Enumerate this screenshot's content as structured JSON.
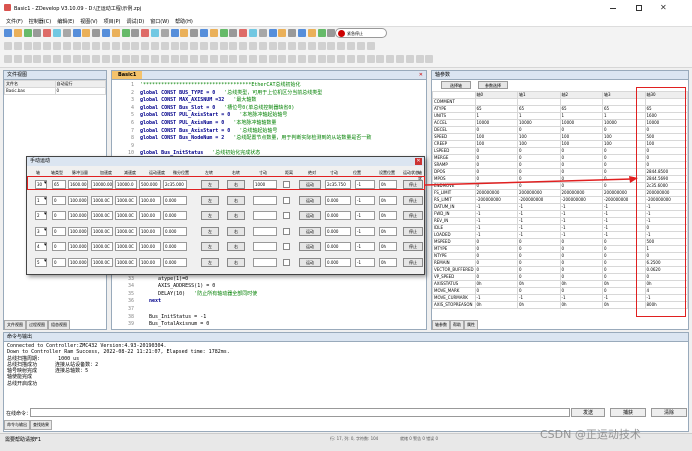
{
  "app": {
    "title": "Basic1 - ZDevelop V3.10.09 - D:\\正运动工程\\示例.zpj",
    "menus": [
      "文件(F)",
      "控制器(C)",
      "编辑(E)",
      "视图(V)",
      "项目(P)",
      "调试(D)",
      "窗口(W)",
      "帮助(H)"
    ],
    "stop_label": "紧急停止"
  },
  "file_view": {
    "title": "文件视图",
    "col_name": "文件名",
    "col_autorun": "自动运行",
    "file_name": "Basic.bas",
    "autorun": "0",
    "tabs": [
      "文件视图",
      "过程视图",
      "组态视图"
    ]
  },
  "editor": {
    "tab": "Basic1",
    "lines": [
      {
        "n": "1",
        "t": "'************************************EtherCAT总线初始化"
      },
      {
        "n": "2",
        "t": "global CONST BUS_TYPE = 0",
        "c": "'总线类型，可用于上位机区分当前总线类型"
      },
      {
        "n": "3",
        "t": "global CONST MAX_AXISNUM =32",
        "c": "'最大轴数"
      },
      {
        "n": "4",
        "t": "global CONST Bus_Slot = 0",
        "c": "'槽位号0(单总线控制器缺省0)"
      },
      {
        "n": "5",
        "t": "global CONST PUL_AxisStart = 0",
        "c": "'本地脉冲轴起始轴号"
      },
      {
        "n": "6",
        "t": "global CONST PUL_AxisNum = 0",
        "c": "'本地脉冲轴轴数量"
      },
      {
        "n": "7",
        "t": "global CONST Bus_AxisStart = 0",
        "c": "'总线轴起始轴号"
      },
      {
        "n": "8",
        "t": "global CONST Bus_NodeNum = 2",
        "c": "'总线配置节点数量，用于判断实际检测到的从站数量是否一致"
      },
      {
        "n": "9",
        "t": ""
      },
      {
        "n": "10",
        "t": "global Bus_InitStatus",
        "c": "'总线初始化完成状态"
      },
      {
        "n": "11",
        "t": "Bus_InitStatus = -1"
      },
      {
        "n": "12",
        "t": "global  Bus_TotalAxisnum",
        "c": "'检查扫描的总轴数"
      }
    ],
    "lines_bottom": [
      {
        "n": "32",
        "t": "      AXIS_ENABLE(1) = 0"
      },
      {
        "n": "33",
        "t": "      atype(1)=0"
      },
      {
        "n": "34",
        "t": "      AXIS_ADDRESS(1) = 0"
      },
      {
        "n": "35",
        "t": "      DELAY(10)",
        "c": "'防止所有轴动器全部同时使"
      },
      {
        "n": "36",
        "t": "   next"
      },
      {
        "n": "37",
        "t": ""
      },
      {
        "n": "38",
        "t": "   Bus_InitStatus = -1"
      },
      {
        "n": "39",
        "t": "   Bus_TotalAxisnum = 0"
      }
    ]
  },
  "dialog": {
    "title": "手动运动",
    "headers": [
      "轴",
      "轴类型",
      "脉冲当量",
      "加速度",
      "减速度",
      "运动速度",
      "微分位置",
      "左转",
      "右转",
      "寸动",
      "距离",
      "绝对",
      "寸动",
      "位置",
      "设置位置",
      "运动状态",
      "轴状态"
    ],
    "rows": [
      {
        "axis": "30",
        "atype": "65",
        "units": "1600.00",
        "accel": "10000.00",
        "decel": "10000.0",
        "speed": "500.000",
        "pos": "2c35.000",
        "left": "左",
        "right": "右",
        "dist": "1000",
        "jog": "运动",
        "dpos": "2c35.750",
        "mtype": "-1",
        "status": "0h",
        "stop": "停止"
      },
      {
        "axis": "1",
        "atype": "0",
        "units": "100.000",
        "accel": "1000.0C",
        "decel": "1000.0C",
        "speed": "100.00",
        "pos": "0.000",
        "left": "左",
        "right": "右",
        "dist": "",
        "jog": "运动",
        "dpos": "0.000",
        "mtype": "-1",
        "status": "0h",
        "stop": "停止"
      },
      {
        "axis": "2",
        "atype": "0",
        "units": "100.000",
        "accel": "1000.0C",
        "decel": "1000.0C",
        "speed": "100.00",
        "pos": "0.000",
        "left": "左",
        "right": "右",
        "dist": "",
        "jog": "运动",
        "dpos": "0.000",
        "mtype": "-1",
        "status": "0h",
        "stop": "停止"
      },
      {
        "axis": "3",
        "atype": "0",
        "units": "100.000",
        "accel": "1000.0C",
        "decel": "1000.0C",
        "speed": "100.00",
        "pos": "0.000",
        "left": "左",
        "right": "右",
        "dist": "",
        "jog": "运动",
        "dpos": "0.000",
        "mtype": "-1",
        "status": "0h",
        "stop": "停止"
      },
      {
        "axis": "4",
        "atype": "0",
        "units": "100.000",
        "accel": "1000.0C",
        "decel": "1000.0C",
        "speed": "100.00",
        "pos": "0.000",
        "left": "左",
        "right": "右",
        "dist": "",
        "jog": "运动",
        "dpos": "0.000",
        "mtype": "-1",
        "status": "0h",
        "stop": "停止"
      },
      {
        "axis": "5",
        "atype": "0",
        "units": "100.000",
        "accel": "1000.0C",
        "decel": "1000.0C",
        "speed": "100.00",
        "pos": "0.000",
        "left": "左",
        "right": "右",
        "dist": "",
        "jog": "运动",
        "dpos": "0.000",
        "mtype": "-1",
        "status": "0h",
        "stop": "停止"
      }
    ]
  },
  "axis_params": {
    "title": "轴参数",
    "btn_select": "选择轴",
    "btn_params": "参数选择",
    "cols": [
      "轴0",
      "轴1",
      "轴2",
      "轴3",
      "轴30"
    ],
    "rows": [
      {
        "name": "COMMENT",
        "v": [
          "",
          "",
          "",
          "",
          ""
        ]
      },
      {
        "name": "ATYPE",
        "v": [
          "65",
          "65",
          "65",
          "65",
          "65"
        ]
      },
      {
        "name": "UNITS",
        "v": [
          "1",
          "1",
          "1",
          "1",
          "1600"
        ]
      },
      {
        "name": "ACCEL",
        "v": [
          "10000",
          "10000",
          "10000",
          "10000",
          "10000"
        ]
      },
      {
        "name": "DECEL",
        "v": [
          "0",
          "0",
          "0",
          "0",
          "0"
        ]
      },
      {
        "name": "SPEED",
        "v": [
          "100",
          "100",
          "100",
          "100",
          "500"
        ]
      },
      {
        "name": "CREEP",
        "v": [
          "100",
          "100",
          "100",
          "100",
          "100"
        ]
      },
      {
        "name": "LSPEED",
        "v": [
          "0",
          "0",
          "0",
          "0",
          "0"
        ]
      },
      {
        "name": "MERGE",
        "v": [
          "0",
          "0",
          "0",
          "0",
          "0"
        ]
      },
      {
        "name": "SRAMP",
        "v": [
          "0",
          "0",
          "0",
          "0",
          "0"
        ]
      },
      {
        "name": "DPOS",
        "v": [
          "0",
          "0",
          "0",
          "0",
          "2844.8500"
        ]
      },
      {
        "name": "MPOS",
        "v": [
          "0",
          "0",
          "0",
          "0",
          "2844.5690"
        ]
      },
      {
        "name": "ENDMOVE",
        "v": [
          "0",
          "0",
          "0",
          "0",
          "2c35.6000"
        ]
      },
      {
        "name": "FS_LIMIT",
        "v": [
          "200000000",
          "200000000",
          "200000000",
          "200000000",
          "200000000"
        ]
      },
      {
        "name": "RS_LIMIT",
        "v": [
          "-200000000",
          "-200000000",
          "-200000000",
          "-200000000",
          "-200000000"
        ]
      },
      {
        "name": "DATUM_IN",
        "v": [
          "-1",
          "-1",
          "-1",
          "-1",
          "-1"
        ]
      },
      {
        "name": "FWD_IN",
        "v": [
          "-1",
          "-1",
          "-1",
          "-1",
          "-1"
        ]
      },
      {
        "name": "REV_IN",
        "v": [
          "-1",
          "-1",
          "-1",
          "-1",
          "-1"
        ]
      },
      {
        "name": "IDLE",
        "v": [
          "-1",
          "-1",
          "-1",
          "-1",
          "0"
        ]
      },
      {
        "name": "LOADED",
        "v": [
          "-1",
          "-1",
          "-1",
          "-1",
          "-1"
        ]
      },
      {
        "name": "MSPEED",
        "v": [
          "0",
          "0",
          "0",
          "0",
          "500"
        ]
      },
      {
        "name": "MTYPE",
        "v": [
          "0",
          "0",
          "0",
          "0",
          "1"
        ]
      },
      {
        "name": "NTYPE",
        "v": [
          "0",
          "0",
          "0",
          "0",
          "0"
        ]
      },
      {
        "name": "REMAIN",
        "v": [
          "0",
          "0",
          "0",
          "0",
          "6.2500"
        ]
      },
      {
        "name": "VECTOR_BUFFERED",
        "v": [
          "0",
          "0",
          "0",
          "0",
          "0.0620"
        ]
      },
      {
        "name": "VP_SPEED",
        "v": [
          "0",
          "0",
          "0",
          "0",
          "0"
        ]
      },
      {
        "name": "AXISSTATUS",
        "v": [
          "0h",
          "0h",
          "0h",
          "0h",
          "0h"
        ]
      },
      {
        "name": "MOVE_MARK",
        "v": [
          "0",
          "0",
          "0",
          "0",
          "4"
        ]
      },
      {
        "name": "MOVE_CURMARK",
        "v": [
          "-1",
          "-1",
          "-1",
          "-1",
          "-1"
        ]
      },
      {
        "name": "AXIS_STOPREASON",
        "v": [
          "0h",
          "0h",
          "0h",
          "0h",
          "800h"
        ]
      }
    ],
    "tabs": [
      "轴参数",
      "帮助",
      "属性"
    ]
  },
  "output": {
    "title": "命令与输出",
    "lines": [
      "Connected to Controller:ZMC432 Version:4.93-20190304.",
      "Down to Controller Ram Success, 2022-08-22 11:21:07, Elapsed time: 1782ms.",
      "总线扫描周期:      1000 us",
      "总线扫描成功      连接从站设备数：2",
      "轴号映射完成      连接总轴数：5",
      "轴使能完成",
      "总线开启成功"
    ],
    "input_label": "在线命令：",
    "send": "发送",
    "capture": "捕获",
    "clear": "清除",
    "tabs": [
      "命令与输出",
      "查找结果"
    ]
  },
  "status": {
    "left": "需要帮助请按F1",
    "middle": "行: 17, 列: 0, 字符数: 104",
    "right": "就绪 0 警告 0 错误 0"
  },
  "watermark": "CSDN @正运动技术"
}
